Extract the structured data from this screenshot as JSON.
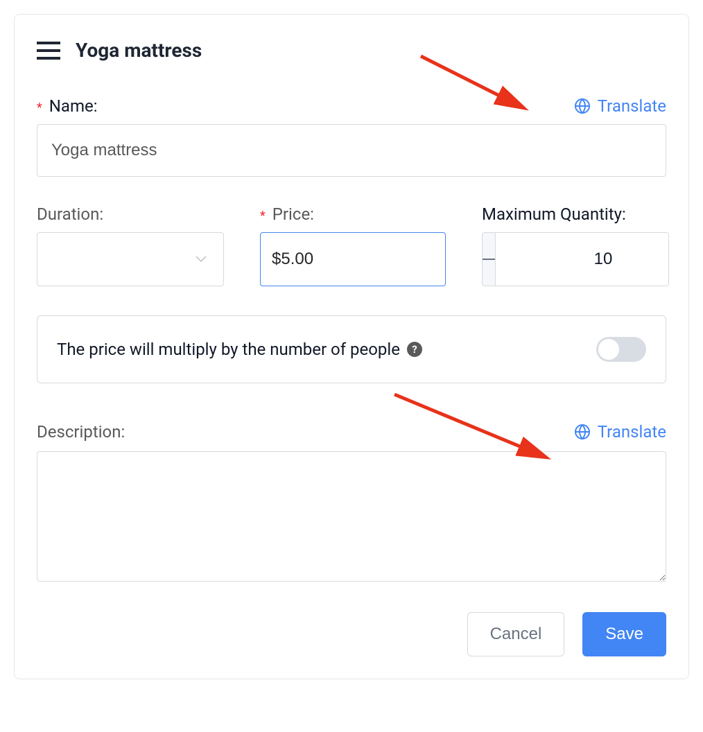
{
  "header": {
    "title": "Yoga mattress"
  },
  "name": {
    "label": "Name:",
    "value": "Yoga mattress",
    "translate_label": "Translate"
  },
  "duration": {
    "label": "Duration:",
    "value": ""
  },
  "price": {
    "label": "Price:",
    "value": "$5.00"
  },
  "quantity": {
    "label": "Maximum Quantity:",
    "value": "10"
  },
  "multiply_info": {
    "text": "The price will multiply by the number of people",
    "toggle_on": false
  },
  "description": {
    "label": "Description:",
    "translate_label": "Translate",
    "value": ""
  },
  "buttons": {
    "cancel": "Cancel",
    "save": "Save"
  },
  "colors": {
    "primary": "#4285f4",
    "required": "#f5222d"
  }
}
